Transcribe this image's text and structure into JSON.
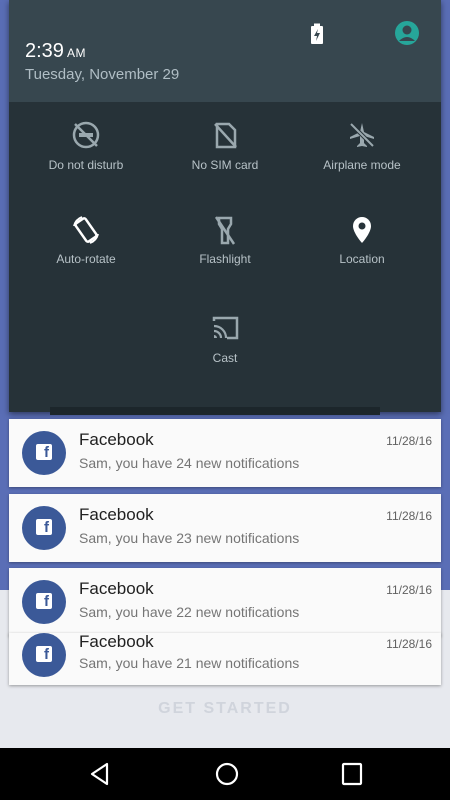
{
  "status": {
    "time": "2:39",
    "ampm": "AM",
    "date": "Tuesday, November 29"
  },
  "tiles": [
    {
      "label": "Do not disturb",
      "icon": "do-not-disturb-icon"
    },
    {
      "label": "No SIM card",
      "icon": "no-sim-icon"
    },
    {
      "label": "Airplane mode",
      "icon": "airplane-icon"
    },
    {
      "label": "Auto-rotate",
      "icon": "auto-rotate-icon"
    },
    {
      "label": "Flashlight",
      "icon": "flashlight-icon"
    },
    {
      "label": "Location",
      "icon": "location-icon"
    },
    {
      "label": "Cast",
      "icon": "cast-icon"
    }
  ],
  "notifications": [
    {
      "app": "Facebook",
      "message": "Sam, you have 24 new notifications",
      "date": "11/28/16"
    },
    {
      "app": "Facebook",
      "message": "Sam, you have 23 new notifications",
      "date": "11/28/16"
    },
    {
      "app": "Facebook",
      "message": "Sam, you have 22 new notifications",
      "date": "11/28/16"
    },
    {
      "app": "Facebook",
      "message": "Sam, you have 21 new notifications",
      "date": "11/28/16"
    }
  ],
  "background": {
    "button_text": "GET STARTED"
  },
  "colors": {
    "shade": "#263238",
    "header": "#37474f",
    "facebook": "#3b5998",
    "app_background": "#5a6eb6"
  }
}
